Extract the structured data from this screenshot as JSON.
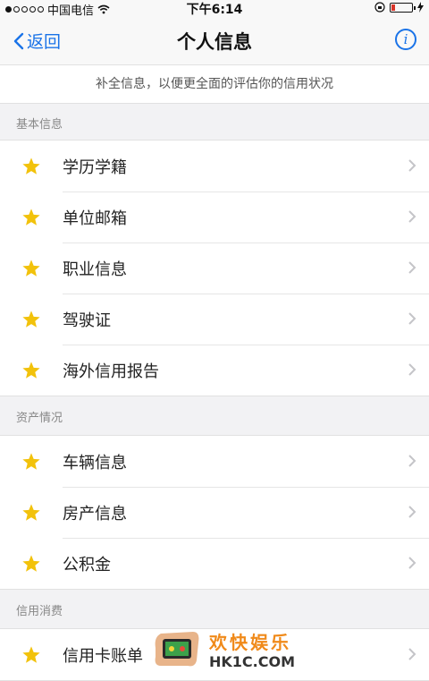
{
  "status_bar": {
    "carrier": "中国电信",
    "time": "下午6:14"
  },
  "nav": {
    "back_label": "返回",
    "title": "个人信息",
    "info_icon": "info-icon"
  },
  "notice": "补全信息，以便更全面的评估你的信用状况",
  "sections": [
    {
      "header": "基本信息",
      "items": [
        {
          "label": "学历学籍"
        },
        {
          "label": "单位邮箱"
        },
        {
          "label": "职业信息"
        },
        {
          "label": "驾驶证"
        },
        {
          "label": "海外信用报告"
        }
      ]
    },
    {
      "header": "资产情况",
      "items": [
        {
          "label": "车辆信息"
        },
        {
          "label": "房产信息"
        },
        {
          "label": "公积金"
        }
      ]
    },
    {
      "header": "信用消费",
      "items": [
        {
          "label": "信用卡账单"
        }
      ]
    }
  ],
  "watermark": {
    "title": "欢快娱乐",
    "site": "HK1C.COM"
  },
  "colors": {
    "accent": "#1a73e8",
    "star": "#f2c20b",
    "background": "#f2f2f4"
  }
}
